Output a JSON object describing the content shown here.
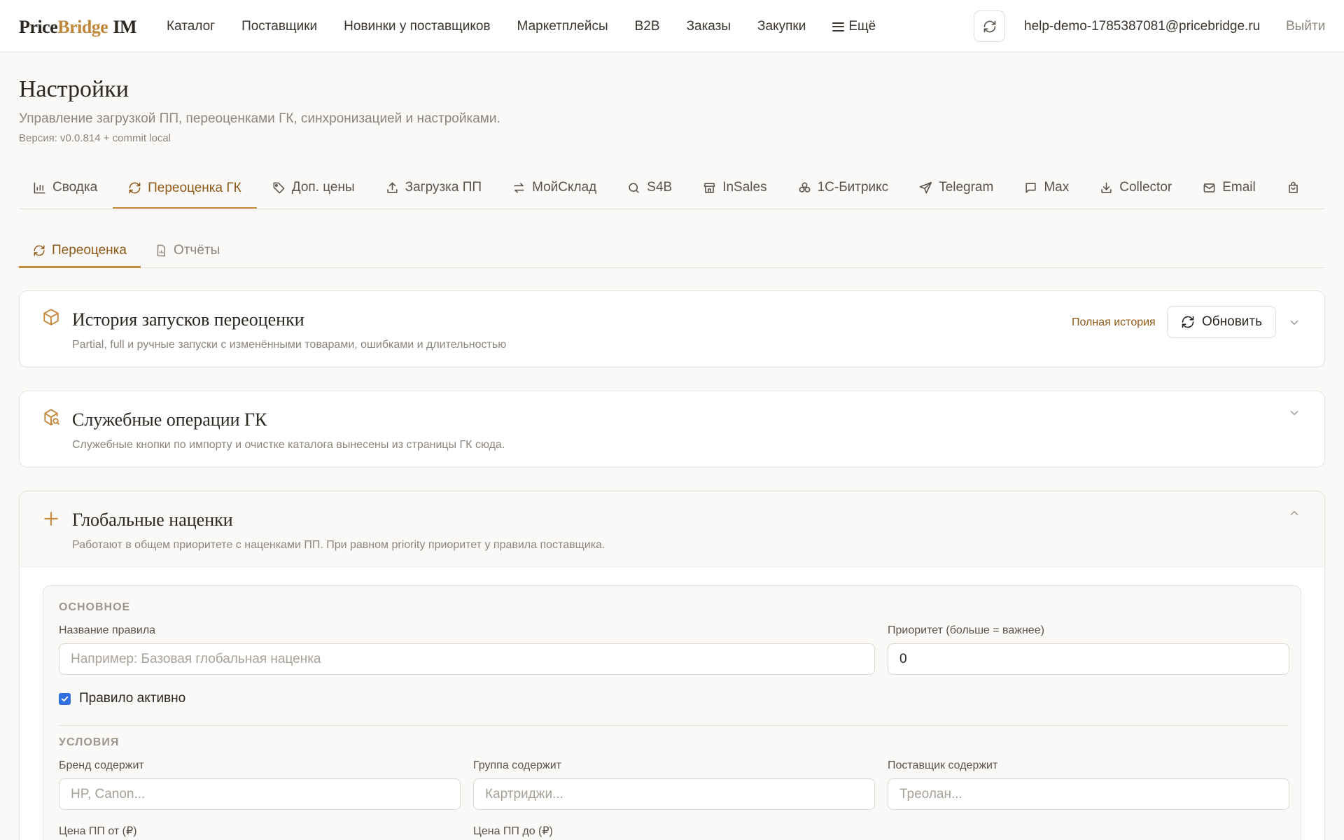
{
  "app": {
    "logo_part1": "Price",
    "logo_part2": "Bridge",
    "logo_part3": "IM",
    "accent_color": "#c58a3d"
  },
  "nav": {
    "items": [
      "Каталог",
      "Поставщики",
      "Новинки у поставщиков",
      "Маркетплейсы",
      "B2B",
      "Заказы",
      "Закупки"
    ],
    "more_label": "Ещё",
    "user_email": "help-demo-1785387081@pricebridge.ru",
    "logout_label": "Выйти"
  },
  "header": {
    "title": "Настройки",
    "subtitle": "Управление загрузкой ПП, переоценками ГК, синхронизацией и настройками.",
    "version": "Версия: v0.0.814 + commit local"
  },
  "tabs": [
    {
      "label": "Сводка",
      "icon": "bar-chart-icon"
    },
    {
      "label": "Переоценка ГК",
      "icon": "refresh-icon",
      "active": true
    },
    {
      "label": "Доп. цены",
      "icon": "tag-icon"
    },
    {
      "label": "Загрузка ПП",
      "icon": "upload-icon"
    },
    {
      "label": "МойСклад",
      "icon": "arrows-swap-icon"
    },
    {
      "label": "S4B",
      "icon": "search-icon"
    },
    {
      "label": "InSales",
      "icon": "store-icon"
    },
    {
      "label": "1С-Битрикс",
      "icon": "circles-icon"
    },
    {
      "label": "Telegram",
      "icon": "send-icon"
    },
    {
      "label": "Max",
      "icon": "message-icon"
    },
    {
      "label": "Collector",
      "icon": "download-icon"
    },
    {
      "label": "Email",
      "icon": "mail-icon"
    },
    {
      "label": "",
      "icon": "shopping-bag-icon"
    }
  ],
  "subtabs": [
    {
      "label": "Переоценка",
      "icon": "refresh-icon",
      "active": true
    },
    {
      "label": "Отчёты",
      "icon": "report-icon"
    }
  ],
  "history_card": {
    "title": "История запусков переоценки",
    "description": "Partial, full и ручные запуски с изменёнными товарами, ошибками и длительностью",
    "full_history_link": "Полная история",
    "refresh_label": "Обновить"
  },
  "service_card": {
    "title": "Служебные операции ГК",
    "description": "Служебные кнопки по импорту и очистке каталога вынесены из страницы ГК сюда."
  },
  "markup_card": {
    "title": "Глобальные наценки",
    "description": "Работают в общем приоритете с наценками ПП. При равном priority приоритет у правила поставщика.",
    "form": {
      "section_main": "ОСНОВНОЕ",
      "rule_name_label": "Название правила",
      "rule_name_placeholder": "Например: Базовая глобальная наценка",
      "priority_label": "Приоритет (больше = важнее)",
      "priority_value": "0",
      "active_label": "Правило активно",
      "active_checked": true,
      "section_conditions": "УСЛОВИЯ",
      "brand_label": "Бренд содержит",
      "brand_placeholder": "HP, Canon...",
      "group_label": "Группа содержит",
      "group_placeholder": "Картриджи...",
      "supplier_label": "Поставщик содержит",
      "supplier_placeholder": "Треолан...",
      "price_from_label": "Цена ПП от (₽)",
      "price_to_label": "Цена ПП до (₽)"
    }
  }
}
